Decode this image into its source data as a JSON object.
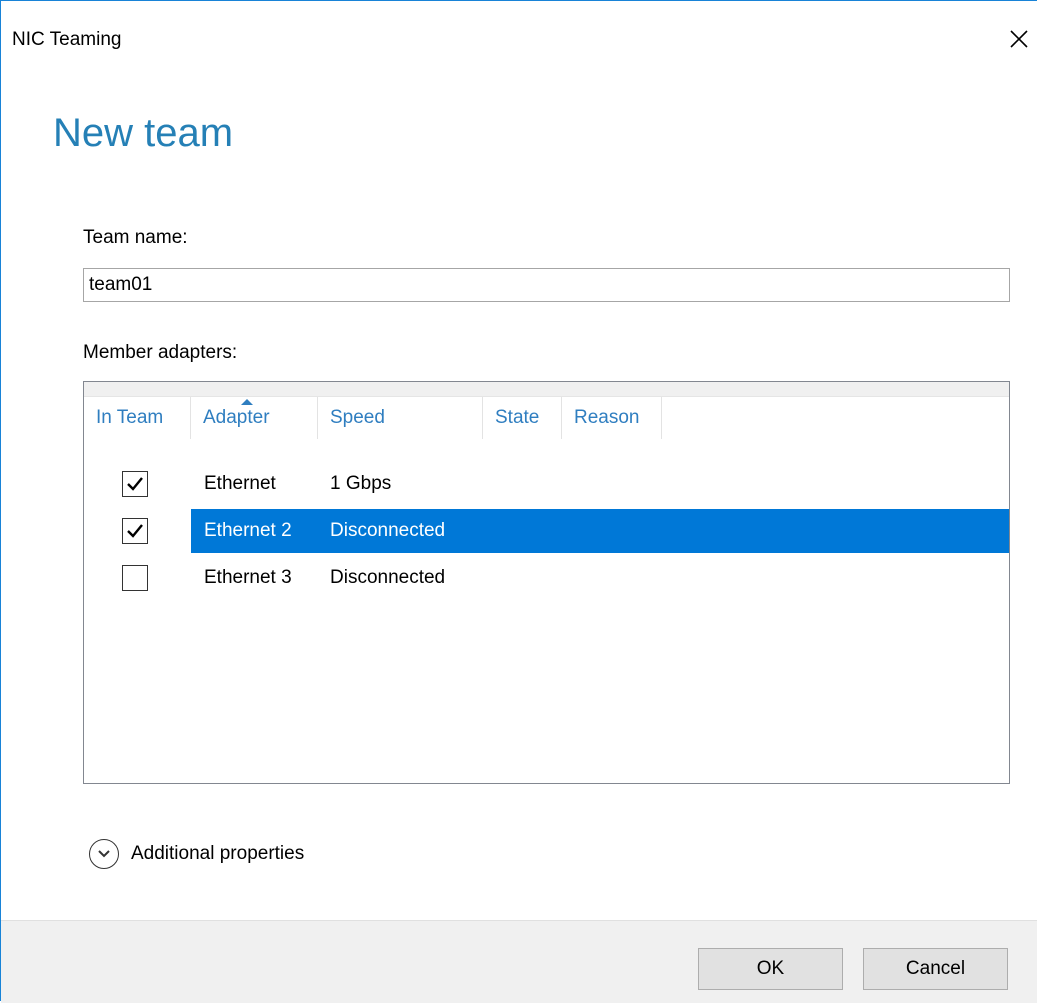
{
  "window": {
    "title": "NIC Teaming"
  },
  "page": {
    "heading": "New team"
  },
  "team_name": {
    "label": "Team name:",
    "value": "team01"
  },
  "members": {
    "label": "Member adapters:",
    "columns": [
      "In Team",
      "Adapter",
      "Speed",
      "State",
      "Reason"
    ],
    "sorted_column": "Adapter",
    "rows": [
      {
        "in_team": true,
        "adapter": "Ethernet",
        "speed": "1 Gbps",
        "state": "",
        "reason": "",
        "selected": false
      },
      {
        "in_team": true,
        "adapter": "Ethernet 2",
        "speed": "Disconnected",
        "state": "",
        "reason": "",
        "selected": true
      },
      {
        "in_team": false,
        "adapter": "Ethernet 3",
        "speed": "Disconnected",
        "state": "",
        "reason": "",
        "selected": false
      }
    ]
  },
  "additional_properties": {
    "label": "Additional properties"
  },
  "buttons": {
    "ok": "OK",
    "cancel": "Cancel"
  },
  "colors": {
    "accent": "#2580b6",
    "header_text": "#2f7ec0",
    "selection": "#0078d7",
    "window_border": "#1883d7"
  }
}
